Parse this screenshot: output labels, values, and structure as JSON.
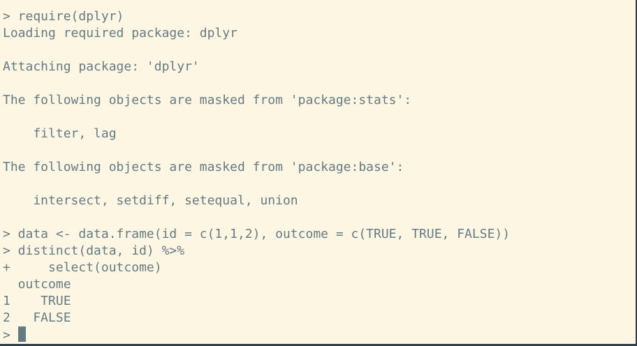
{
  "console": {
    "lines": [
      "> require(dplyr)",
      "Loading required package: dplyr",
      "",
      "Attaching package: 'dplyr'",
      "",
      "The following objects are masked from 'package:stats':",
      "",
      "    filter, lag",
      "",
      "The following objects are masked from 'package:base':",
      "",
      "    intersect, setdiff, setequal, union",
      "",
      "> data <- data.frame(id = c(1,1,2), outcome = c(TRUE, TRUE, FALSE))",
      "> distinct(data, id) %>%",
      "+     select(outcome)",
      "  outcome",
      "1    TRUE",
      "2   FALSE"
    ],
    "prompt": "> "
  },
  "colors": {
    "background": "#fdf6e3",
    "text": "#657b83",
    "window_border": "#2d3e4a"
  }
}
